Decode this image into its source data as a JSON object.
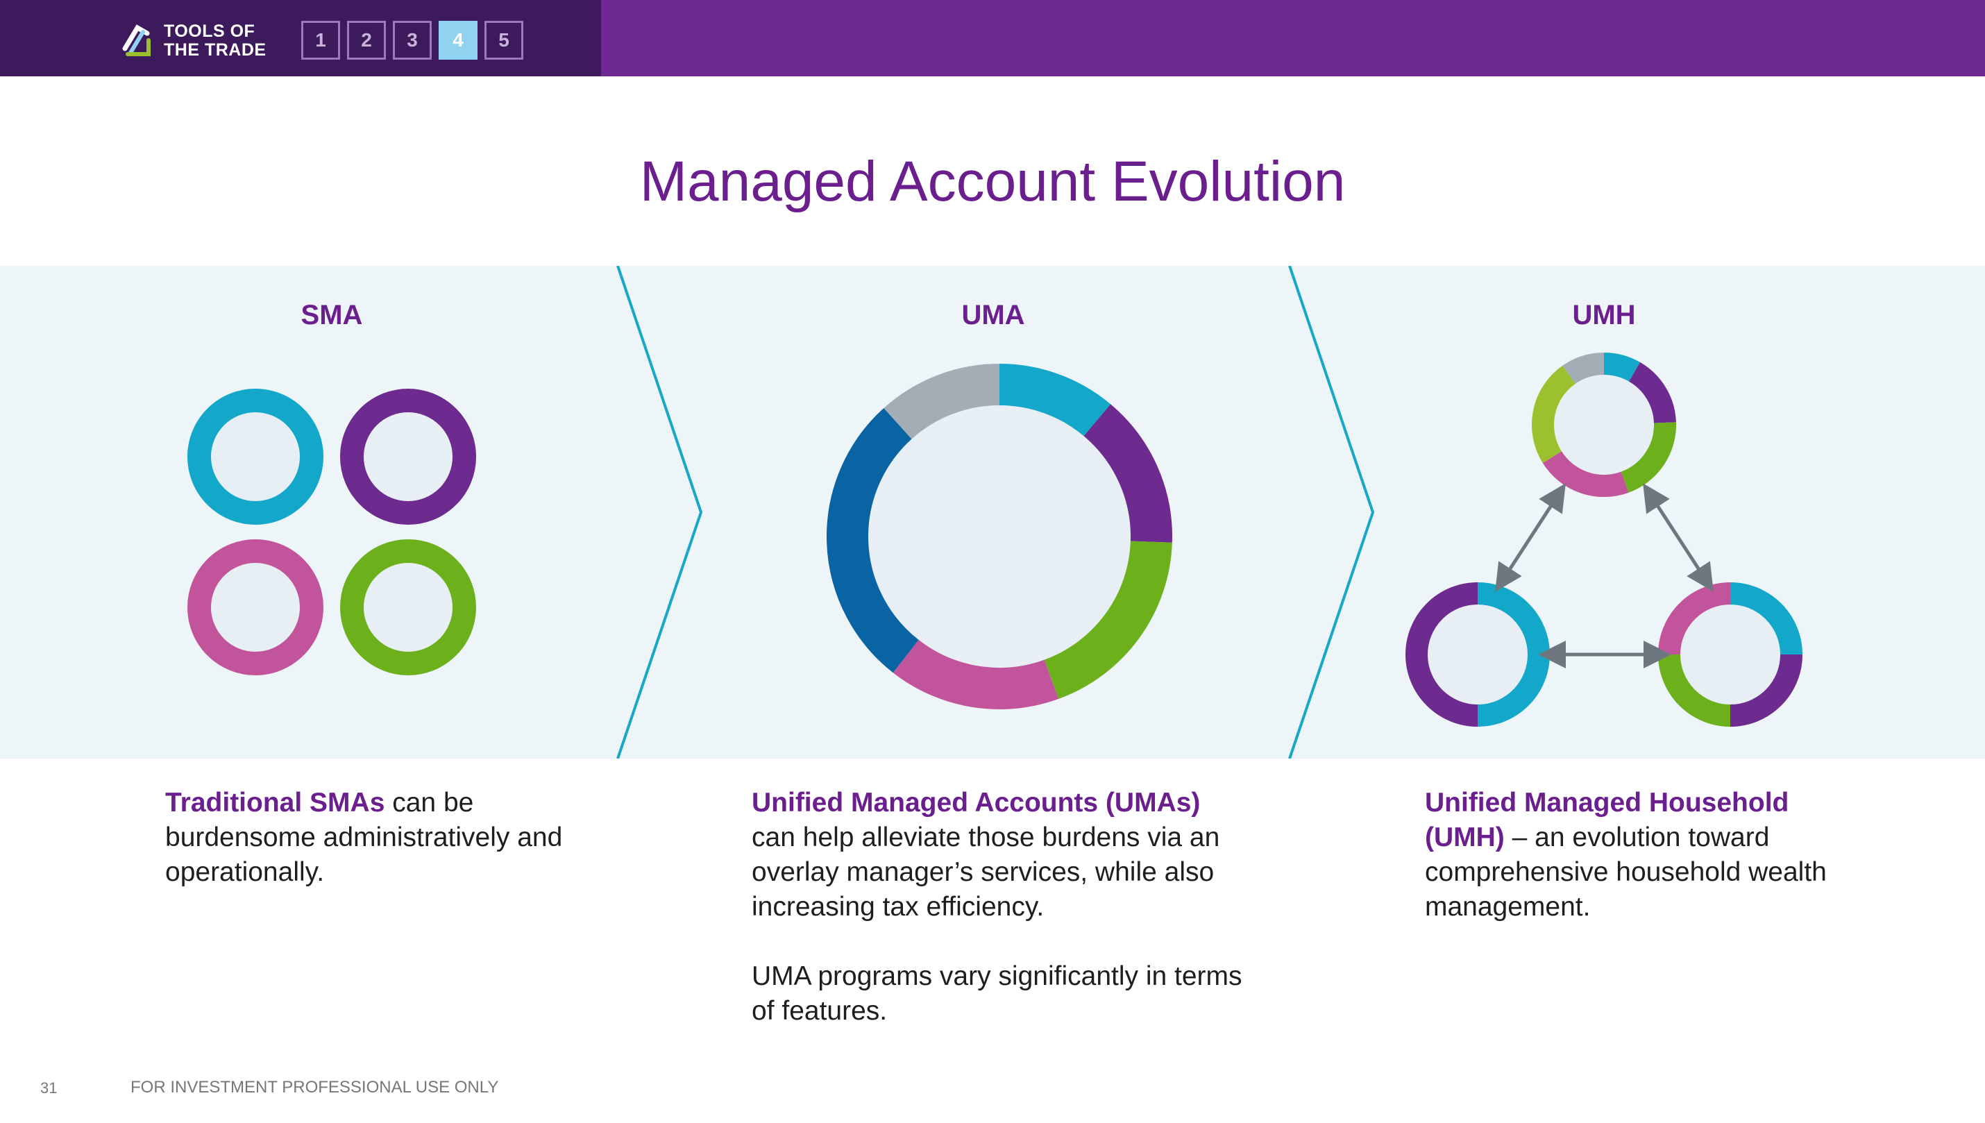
{
  "header": {
    "logo_line1": "TOOLS OF",
    "logo_line2": "THE TRADE",
    "nav": [
      "1",
      "2",
      "3",
      "4",
      "5"
    ],
    "active_index": 3
  },
  "title": "Managed Account Evolution",
  "colors": {
    "purple_title": "#6b1f8e",
    "teal": "#13a8c9",
    "purple": "#6d2a8f",
    "pink": "#c2549b",
    "green": "#6cb01c",
    "blue": "#0a64a4",
    "gray": "#a3adb5",
    "lime": "#9cc12e",
    "band": "#eef5f8",
    "chevron": "#17a7c7"
  },
  "sections": [
    {
      "label": "SMA",
      "highlight": "Traditional SMAs",
      "text": " can be burdensome administratively and operationally.",
      "extra": ""
    },
    {
      "label": "UMA",
      "highlight": "Unified Managed Accounts (UMAs)",
      "text": " can help alleviate those burdens via an overlay manager’s services, while also increasing tax efficiency.",
      "extra": "UMA programs vary significantly in terms of features."
    },
    {
      "label": "UMH",
      "highlight": "Unified Managed Household (UMH)",
      "text": " – an evolution toward comprehensive household wealth management.",
      "extra": ""
    }
  ],
  "footer": {
    "page_number": "31",
    "disclaimer": "FOR INVESTMENT PROFESSIONAL USE ONLY"
  }
}
